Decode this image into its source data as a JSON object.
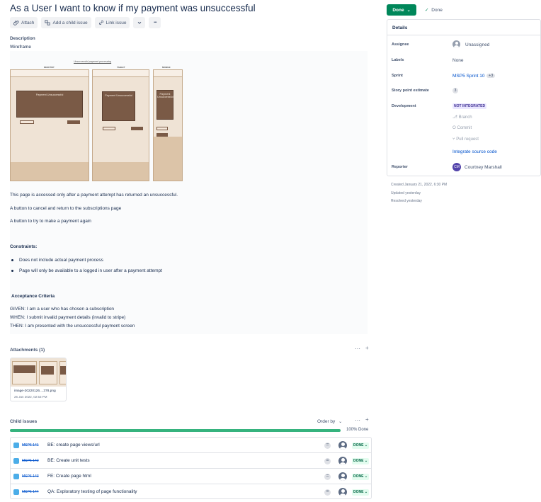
{
  "issue": {
    "title": "As a User I want to know if my payment was unsuccessful"
  },
  "toolbar": {
    "attach_label": "Attach",
    "child_issue_label": "Add a child issue",
    "link_issue_label": "Link issue",
    "more_label": "•••"
  },
  "description": {
    "label": "Description",
    "wireframe_label": "Wireframe",
    "wireframe": {
      "title": "Unsuccessful payment processing",
      "desktop_label": "DESKTOP",
      "tablet_label": "TABLET",
      "mobile_label": "MOBILE",
      "message": "Payment Unsuccessful"
    },
    "paragraphs": [
      "This page is accessed only after a payment attempt has returned an unsuccessful.",
      "A button to cancel and return to the subscriptions page",
      "A button to try to make a payment again"
    ],
    "constraints_heading": "Constraints:",
    "constraints": [
      "Does not include actual payment process",
      "Page will only be available to a logged in user after a payment attempt"
    ],
    "acceptance_heading": "Acceptance Criteria",
    "acceptance": [
      "GIVEN: I am a user who has chosen a subscription",
      "WHEN: I submit invalid payment details (invalid to stripe)",
      "THEN: I am presented with the unsuccessful payment screen"
    ]
  },
  "attachments": {
    "label": "Attachments (1)",
    "file_name": "image-20220126....378.png",
    "file_date": "26 Jan 2022, 02:53 PM"
  },
  "child_issues": {
    "label": "Child issues",
    "order_by": "Order by",
    "progress_percent": 100,
    "progress_label": "100% Done",
    "items": [
      {
        "key": "MSP6-141",
        "summary": "BE: create page views/url",
        "status": "DONE"
      },
      {
        "key": "MSP6-142",
        "summary": "BE: Create unit tests",
        "status": "DONE"
      },
      {
        "key": "MSP6-143",
        "summary": "FE: Create page html",
        "status": "DONE"
      },
      {
        "key": "MSP6-144",
        "summary": "QA: Exploratory testing of page functionality",
        "status": "DONE"
      }
    ]
  },
  "sidebar": {
    "status_label": "Done",
    "resolution_label": "Done",
    "details_title": "Details",
    "fields": {
      "assignee_label": "Assignee",
      "assignee_value": "Unassigned",
      "labels_label": "Labels",
      "labels_value": "None",
      "sprint_label": "Sprint",
      "sprint_value": "MSP5 Sprint 10",
      "sprint_extra": "+3",
      "story_points_label": "Story point estimate",
      "story_points_value": "3",
      "development_label": "Development",
      "development_status": "NOT INTEGRATED",
      "branch_label": "Branch",
      "commit_label": "Commit",
      "pull_request_label": "Pull request",
      "integrate_label": "Integrate source code",
      "reporter_label": "Reporter",
      "reporter_value": "Courtney Marshall",
      "reporter_initials": "CM"
    },
    "created": "Created January 21, 2022, 6:30 PM",
    "updated": "Updated yesterday",
    "resolved": "Resolved yesterday"
  }
}
